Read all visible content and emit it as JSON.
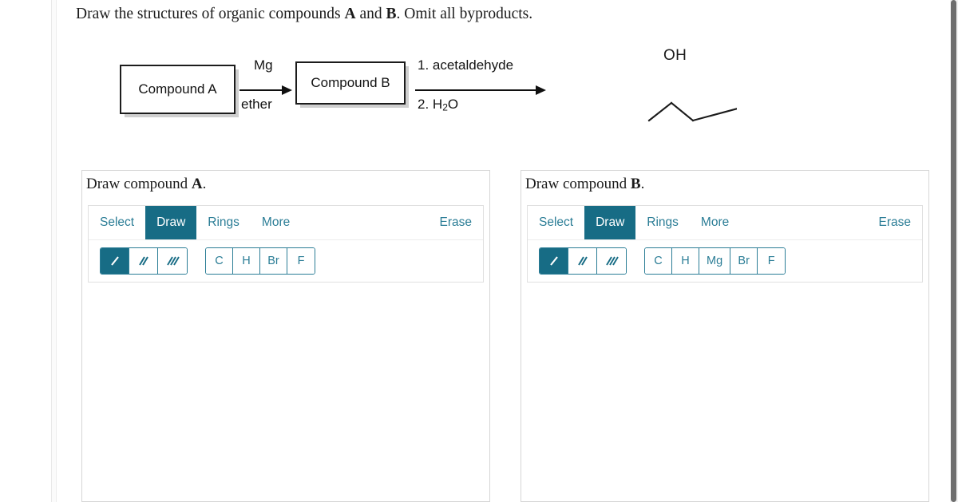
{
  "prompt": {
    "part1": "Draw the structures of organic compounds ",
    "boldA": "A",
    "part2": " and ",
    "boldB": "B",
    "part3": ". Omit all byproducts."
  },
  "scheme": {
    "compound_a_label": "Compound A",
    "compound_b_label": "Compound B",
    "reagent_step1_top": "Mg",
    "reagent_step1_bottom": "ether",
    "reagent_step2_top": "1. acetaldehyde",
    "reagent_step2_bottom_prefix": "2. H",
    "reagent_step2_bottom_sub": "2",
    "reagent_step2_bottom_suffix": "O",
    "product_label": "OH"
  },
  "panels": [
    {
      "title_prefix": "Draw compound ",
      "title_bold": "A",
      "title_suffix": ".",
      "tabs": [
        {
          "label": "Select",
          "active": false
        },
        {
          "label": "Draw",
          "active": true
        },
        {
          "label": "Rings",
          "active": false
        },
        {
          "label": "More",
          "active": false
        }
      ],
      "erase_label": "Erase",
      "bonds": [
        {
          "name": "single-bond",
          "active": true
        },
        {
          "name": "double-bond",
          "active": false
        },
        {
          "name": "triple-bond",
          "active": false
        }
      ],
      "elements": [
        "C",
        "H",
        "Br",
        "F"
      ]
    },
    {
      "title_prefix": "Draw compound ",
      "title_bold": "B",
      "title_suffix": ".",
      "tabs": [
        {
          "label": "Select",
          "active": false
        },
        {
          "label": "Draw",
          "active": true
        },
        {
          "label": "Rings",
          "active": false
        },
        {
          "label": "More",
          "active": false
        }
      ],
      "erase_label": "Erase",
      "bonds": [
        {
          "name": "single-bond",
          "active": true
        },
        {
          "name": "double-bond",
          "active": false
        },
        {
          "name": "triple-bond",
          "active": false
        }
      ],
      "elements": [
        "C",
        "H",
        "Mg",
        "Br",
        "F"
      ]
    }
  ],
  "colors": {
    "accent_teal": "#176c85",
    "accent_teal_text": "#2b7d96",
    "box_border": "#1c1c1c",
    "box_shadow": "#cfcfcf",
    "panel_border": "#d6d6d6"
  }
}
